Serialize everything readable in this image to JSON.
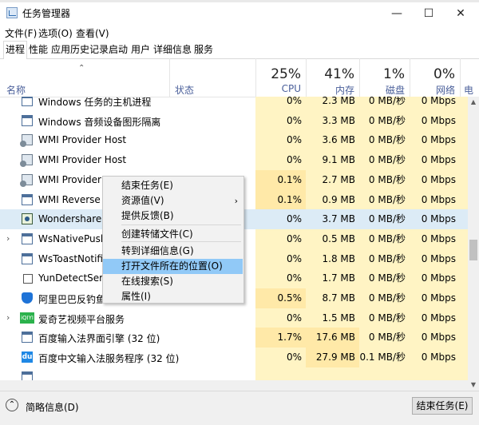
{
  "window": {
    "title": "任务管理器",
    "buttons": {
      "minimize": "—",
      "maximize": "☐",
      "close": "✕"
    }
  },
  "menubar": [
    "文件(F)",
    "选项(O)",
    "查看(V)"
  ],
  "tabs": [
    "进程",
    "性能",
    "应用历史记录",
    "启动",
    "用户",
    "详细信息",
    "服务"
  ],
  "active_tab": "进程",
  "columns": {
    "name": "名称",
    "status": "状态",
    "cpu": {
      "pct": "25%",
      "label": "CPU"
    },
    "memory": {
      "pct": "41%",
      "label": "内存"
    },
    "disk": {
      "pct": "1%",
      "label": "磁盘"
    },
    "network": {
      "pct": "0%",
      "label": "网络"
    },
    "power": {
      "label": "电"
    }
  },
  "processes": [
    {
      "name": "Windows 任务的主机进程",
      "cpu": "0%",
      "mem": "2.3 MB",
      "disk": "0 MB/秒",
      "net": "0 Mbps",
      "icon": "service-icon",
      "expand": false
    },
    {
      "name": "Windows 音频设备图形隔离",
      "cpu": "0%",
      "mem": "3.3 MB",
      "disk": "0 MB/秒",
      "net": "0 Mbps",
      "icon": "window-icon",
      "expand": false
    },
    {
      "name": "WMI Provider Host",
      "cpu": "0%",
      "mem": "3.6 MB",
      "disk": "0 MB/秒",
      "net": "0 Mbps",
      "icon": "gear-app-icon",
      "expand": false
    },
    {
      "name": "WMI Provider Host",
      "cpu": "0%",
      "mem": "9.1 MB",
      "disk": "0 MB/秒",
      "net": "0 Mbps",
      "icon": "gear-app-icon",
      "expand": false
    },
    {
      "name": "WMI Provider H",
      "cpu": "0.1%",
      "mem": "2.7 MB",
      "disk": "0 MB/秒",
      "net": "0 Mbps",
      "icon": "gear-app-icon",
      "expand": false
    },
    {
      "name": "WMI Reverse Pe",
      "cpu": "0.1%",
      "mem": "0.9 MB",
      "disk": "0 MB/秒",
      "net": "0 Mbps",
      "icon": "window-icon",
      "expand": false
    },
    {
      "name": "Wondershare S",
      "cpu": "0%",
      "mem": "3.7 MB",
      "disk": "0 MB/秒",
      "net": "0 Mbps",
      "icon": "wondershare-icon",
      "expand": false,
      "selected": true
    },
    {
      "name": "WsNativePushS",
      "cpu": "0%",
      "mem": "0.5 MB",
      "disk": "0 MB/秒",
      "net": "0 Mbps",
      "icon": "window-icon",
      "expand": true
    },
    {
      "name": "WsToastNotifica",
      "cpu": "0%",
      "mem": "1.8 MB",
      "disk": "0 MB/秒",
      "net": "0 Mbps",
      "icon": "window-icon",
      "expand": false
    },
    {
      "name": "YunDetectServi",
      "cpu": "0%",
      "mem": "1.7 MB",
      "disk": "0 MB/秒",
      "net": "0 Mbps",
      "icon": "yun-icon",
      "expand": false
    },
    {
      "name": "阿里巴巴反钓鱼",
      "cpu": "0.5%",
      "mem": "8.7 MB",
      "disk": "0 MB/秒",
      "net": "0 Mbps",
      "icon": "shield-icon",
      "expand": false
    },
    {
      "name": "爱奇艺视频平台服务",
      "cpu": "0%",
      "mem": "1.5 MB",
      "disk": "0 MB/秒",
      "net": "0 Mbps",
      "icon": "iqiyi-icon",
      "expand": true
    },
    {
      "name": "百度输入法界面引擎 (32 位)",
      "cpu": "1.7%",
      "mem": "17.6 MB",
      "disk": "0 MB/秒",
      "net": "0 Mbps",
      "icon": "window-icon",
      "expand": false
    },
    {
      "name": "百度中文输入法服务程序 (32 位)",
      "cpu": "0%",
      "mem": "27.9 MB",
      "disk": "0.1 MB/秒",
      "net": "0 Mbps",
      "icon": "du-icon",
      "expand": false
    },
    {
      "name": "",
      "cpu": "",
      "mem": "",
      "disk": "",
      "net": "",
      "icon": "window-icon",
      "expand": false
    }
  ],
  "context_menu": {
    "items": [
      "结束任务(E)",
      "资源值(V)",
      "提供反馈(B)",
      "创建转储文件(C)",
      "转到详细信息(G)",
      "打开文件所在的位置(O)",
      "在线搜索(S)",
      "属性(I)"
    ],
    "highlighted": "打开文件所在的位置(O)",
    "submenu_arrow": "›"
  },
  "footer": {
    "fewer_details": "简略信息(D)",
    "end_task": "结束任务(E)"
  },
  "colors": {
    "heat_low": "#fff4c4",
    "heat_mid": "#ffe9a8",
    "selection": "#dcebf6",
    "menu_highlight": "#91c9f7"
  }
}
